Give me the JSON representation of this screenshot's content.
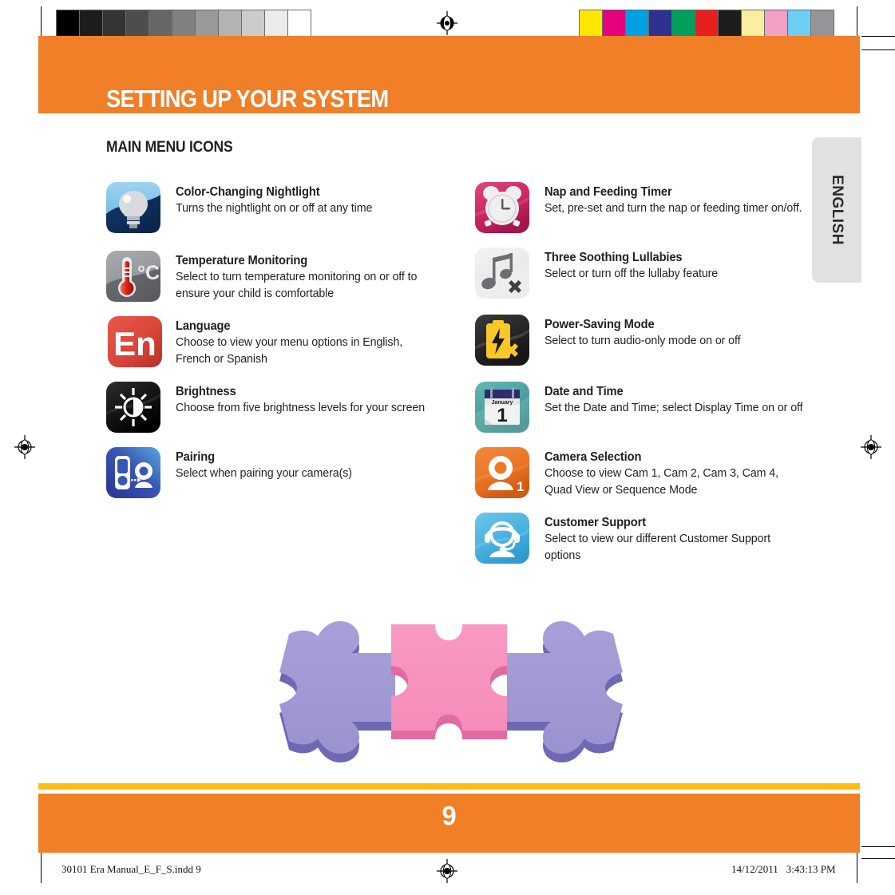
{
  "page": {
    "title": "SETTING UP YOUR SYSTEM",
    "section_heading": "MAIN MENU ICONS",
    "language_tab": "ENGLISH",
    "page_number": "9",
    "colors": {
      "header_orange": "#f07f27",
      "footer_rule_yellow": "#fcbe15",
      "text": "#231f20",
      "tab_gray": "#e0e1e3"
    }
  },
  "prepress": {
    "gray_swatches": [
      "#000000",
      "#1c1c1c",
      "#343434",
      "#4d4d4d",
      "#666666",
      "#808080",
      "#999999",
      "#b3b3b3",
      "#cccccc",
      "#ebebeb",
      "#ffffff"
    ],
    "color_swatches": [
      "#ffe800",
      "#e6007e",
      "#00a0e3",
      "#2e3191",
      "#00a05a",
      "#e81f20",
      "#1d1d1b",
      "#faeea0",
      "#f2a0c4",
      "#6ecff4",
      "#949598"
    ],
    "registration_mark": "registration-target"
  },
  "left_column": [
    {
      "icon": "nightlight-icon",
      "title": "Color-Changing Nightlight",
      "desc": "Turns the nightlight on or off at any time"
    },
    {
      "icon": "thermometer-icon",
      "title": "Temperature Monitoring",
      "desc": "Select to turn temperature monitoring on or off to ensure your child is comfortable"
    },
    {
      "icon": "language-en-icon",
      "title": "Language",
      "desc": "Choose to view your menu options in English, French or Spanish"
    },
    {
      "icon": "brightness-sun-icon",
      "title": "Brightness",
      "desc": "Choose from five brightness levels for your screen"
    },
    {
      "icon": "pairing-icon",
      "title": "Pairing",
      "desc": "Select when pairing your camera(s)"
    }
  ],
  "right_column": [
    {
      "icon": "alarm-clock-icon",
      "title": "Nap and Feeding Timer",
      "desc": "Set, pre-set and turn the nap or feeding timer on/off."
    },
    {
      "icon": "music-notes-off-icon",
      "title": "Three Soothing Lullabies",
      "desc": "Select or turn off the lullaby feature"
    },
    {
      "icon": "battery-power-saving-icon",
      "title": "Power-Saving Mode",
      "desc": "Select to turn audio-only mode on or off"
    },
    {
      "icon": "calendar-icon",
      "title": "Date and Time",
      "desc": "Set the Date and Time; select Display Time on or off"
    },
    {
      "icon": "camera-selection-icon",
      "title": "Camera Selection",
      "desc": "Choose to view Cam 1, Cam 2, Cam 3, Cam 4, Quad View or Sequence Mode"
    },
    {
      "icon": "customer-support-headset-icon",
      "title": "Customer Support",
      "desc": "Select to view our different Customer Support options"
    }
  ],
  "calendar_icon_text": {
    "month": "January",
    "day": "1"
  },
  "graphic": {
    "name": "three-puzzle-pieces",
    "colors": [
      "#9a93cf",
      "#f58cb9",
      "#9a93cf"
    ]
  },
  "imprint": {
    "file": "30101 Era Manual_E_F_S.indd   9",
    "date": "14/12/2011",
    "time": "3:43:13 PM"
  }
}
